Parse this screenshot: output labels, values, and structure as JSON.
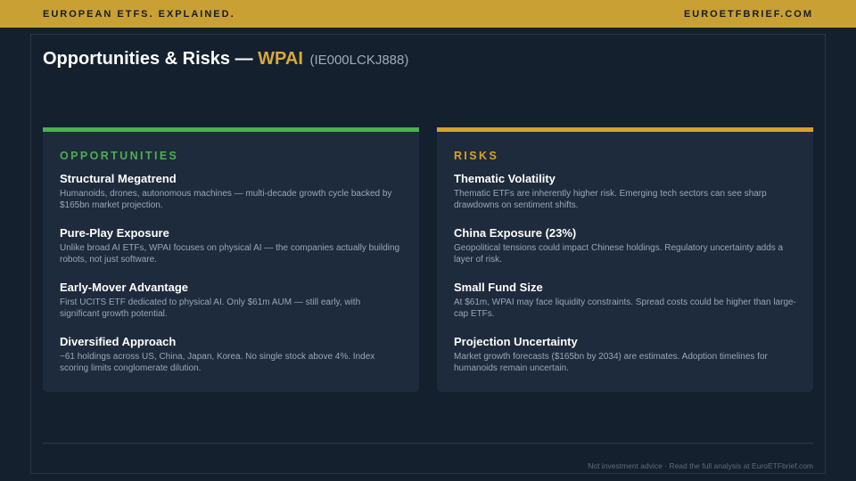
{
  "header": {
    "tagline": "EUROPEAN ETFS. EXPLAINED.",
    "site": "EUROETFBRIEF.COM"
  },
  "title": {
    "prefix": "Opportunities & Risks —",
    "ticker": "WPAI",
    "isin": "(IE000LCKJ888)"
  },
  "opportunities": {
    "heading": "OPPORTUNITIES",
    "items": [
      {
        "title": "Structural Megatrend",
        "desc": "Humanoids, drones, autonomous machines — multi-decade growth cycle backed by $165bn market projection."
      },
      {
        "title": "Pure-Play Exposure",
        "desc": "Unlike broad AI ETFs, WPAI focuses on physical AI — the companies actually building robots, not just software."
      },
      {
        "title": "Early-Mover Advantage",
        "desc": "First UCITS ETF dedicated to physical AI. Only $61m AUM — still early, with significant growth potential."
      },
      {
        "title": "Diversified Approach",
        "desc": "~61 holdings across US, China, Japan, Korea. No single stock above 4%. Index scoring limits conglomerate dilution."
      }
    ]
  },
  "risks": {
    "heading": "RISKS",
    "items": [
      {
        "title": "Thematic Volatility",
        "desc": "Thematic ETFs are inherently higher risk. Emerging tech sectors can see sharp drawdowns on sentiment shifts."
      },
      {
        "title": "China Exposure (23%)",
        "desc": "Geopolitical tensions could impact Chinese holdings. Regulatory uncertainty adds a layer of risk."
      },
      {
        "title": "Small Fund Size",
        "desc": "At $61m, WPAI may face liquidity constraints. Spread costs could be higher than large-cap ETFs."
      },
      {
        "title": "Projection Uncertainty",
        "desc": "Market growth forecasts ($165bn by 2034) are estimates. Adoption timelines for humanoids remain uncertain."
      }
    ]
  },
  "footer": {
    "text": "Not investment advice · Read the full analysis at EuroETFbrief.com"
  },
  "colors": {
    "gold": "#c9a033",
    "background": "#15202f",
    "card": "#1e2b3c",
    "opportunities_accent": "#4caf50",
    "risks_accent": "#d8a228"
  }
}
